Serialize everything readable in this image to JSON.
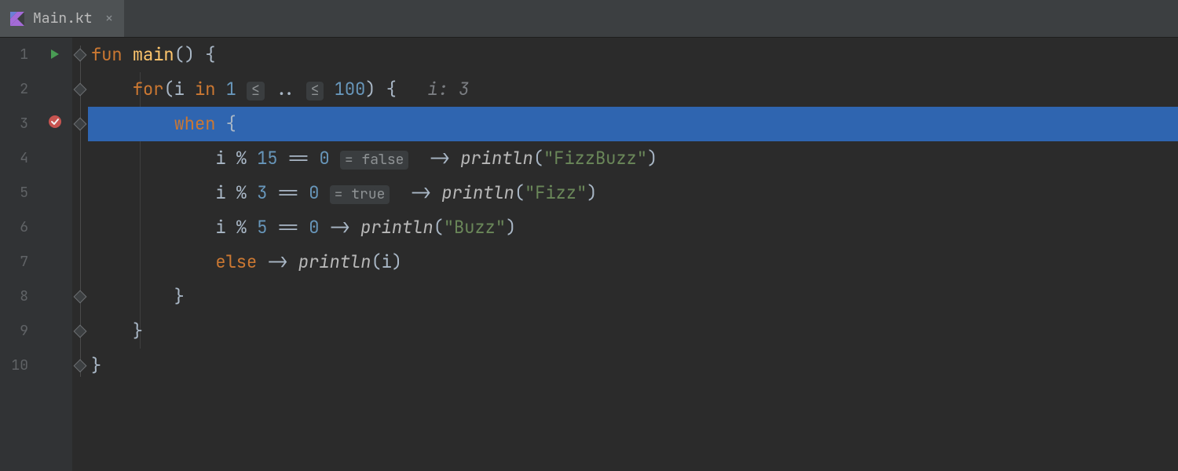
{
  "tab": {
    "filename": "Main.kt",
    "close": "×"
  },
  "gutter": {
    "lines": [
      "1",
      "2",
      "3",
      "4",
      "5",
      "6",
      "7",
      "8",
      "9",
      "10"
    ]
  },
  "code": {
    "l1": {
      "fun": "fun",
      "main": "main",
      "parens": "()",
      "brace": " {"
    },
    "l2": {
      "for": "for",
      "open": "(i",
      "in": " in ",
      "one": "1 ",
      "le1": "≤",
      "range": " .. ",
      "le2": "≤",
      "hundred": " 100",
      "close": ") {",
      "hint_label": "i:",
      "hint_val": " 3"
    },
    "l3": {
      "when": "when",
      "brace": " {"
    },
    "l4": {
      "expr_a": "i % ",
      "n15": "15",
      "eq": " == ",
      "zero": "0 ",
      "hint": "= false",
      "arrow": "  -> ",
      "fn": "println",
      "open": "(",
      "str": "\"FizzBuzz\"",
      "close": ")"
    },
    "l5": {
      "expr_a": "i % ",
      "n3": "3",
      "eq": " == ",
      "zero": "0 ",
      "hint": "= true",
      "arrow": "  -> ",
      "fn": "println",
      "open": "(",
      "str": "\"Fizz\"",
      "close": ")"
    },
    "l6": {
      "expr_a": "i % ",
      "n5": "5",
      "eq": " == ",
      "zero": "0",
      "arrow": " -> ",
      "fn": "println",
      "open": "(",
      "str": "\"Buzz\"",
      "close": ")"
    },
    "l7": {
      "else": "else",
      "arrow": " -> ",
      "fn": "println",
      "open": "(i)",
      "close": ""
    },
    "l8": {
      "brace": "}"
    },
    "l9": {
      "brace": "}"
    },
    "l10": {
      "brace": "}"
    }
  }
}
